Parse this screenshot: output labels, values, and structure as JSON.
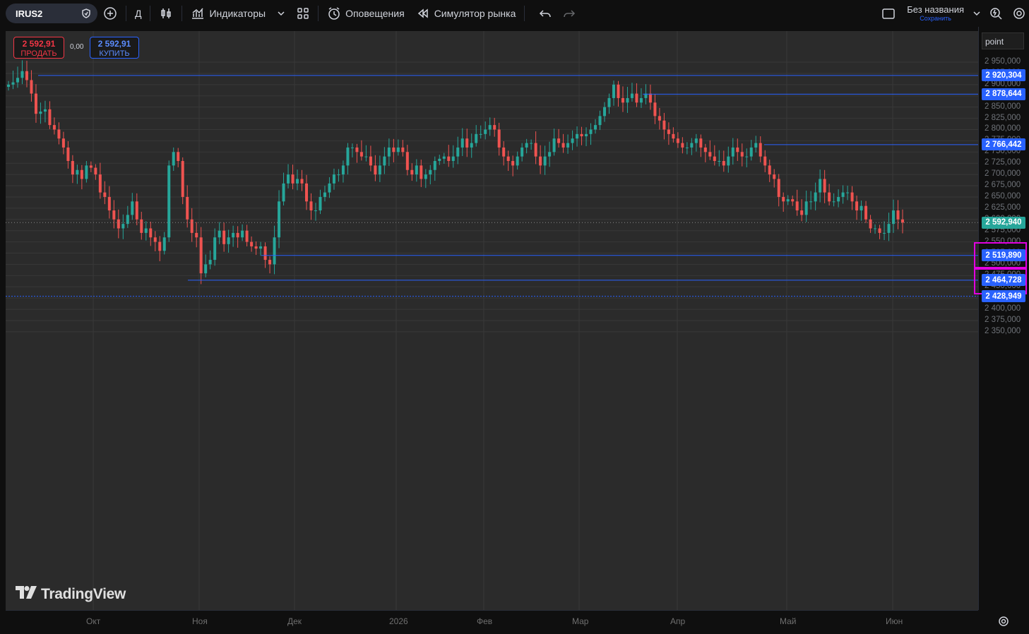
{
  "toolbar": {
    "symbol": "IRUS2",
    "interval": "Д",
    "indicators_label": "Индикаторы",
    "alerts_label": "Оповещения",
    "replay_label": "Симулятор рынка",
    "layout_name": "Без названия",
    "layout_save": "Сохранить"
  },
  "trade": {
    "sell_price": "2 592,91",
    "sell_label": "ПРОДАТЬ",
    "spread": "0,00",
    "buy_price": "2 592,91",
    "buy_label": "КУПИТЬ"
  },
  "price_scale": {
    "mode_label": "point",
    "ticks": [
      "2 950,000",
      "2 925,000",
      "2 900,000",
      "2 875,000",
      "2 850,000",
      "2 825,000",
      "2 800,000",
      "2 775,000",
      "2 750,000",
      "2 725,000",
      "2 700,000",
      "2 675,000",
      "2 650,000",
      "2 625,000",
      "2 600,000",
      "2 575,000",
      "2 550,000",
      "2 525,000",
      "2 500,000",
      "2 475,000",
      "2 450,000",
      "2 425,000",
      "2 400,000",
      "2 375,000",
      "2 350,000"
    ],
    "tick_values": [
      2950,
      2925,
      2900,
      2875,
      2850,
      2825,
      2800,
      2775,
      2750,
      2725,
      2700,
      2675,
      2650,
      2625,
      2600,
      2575,
      2550,
      2525,
      2500,
      2475,
      2450,
      2425,
      2400,
      2375,
      2350
    ]
  },
  "horizontal_lines": [
    {
      "value": 2920.304,
      "label": "2 920,304",
      "color": "#2962ff",
      "highlighted": false
    },
    {
      "value": 2878.644,
      "label": "2 878,644",
      "color": "#2962ff",
      "highlighted": false
    },
    {
      "value": 2766.442,
      "label": "2 766,442",
      "color": "#2962ff",
      "highlighted": false
    },
    {
      "value": 2519.89,
      "label": "2 519,890",
      "color": "#2962ff",
      "highlighted": true
    },
    {
      "value": 2464.728,
      "label": "2 464,728",
      "color": "#2962ff",
      "highlighted": true
    },
    {
      "value": 2428.949,
      "label": "2 428,949",
      "color": "#2962ff",
      "highlighted": false
    }
  ],
  "last_price": {
    "value": 2592.94,
    "label": "2 592,940",
    "color": "#26a69a"
  },
  "time_scale": {
    "labels": [
      "Окт",
      "Ноя",
      "Дек",
      "2026",
      "Фев",
      "Мар",
      "Апр",
      "Май",
      "Июн"
    ]
  },
  "watermark": "TradingView",
  "colors": {
    "up": "#26a69a",
    "down": "#ef5350",
    "background": "#2b2b2b",
    "line": "#2962ff",
    "highlight": "#e100e1"
  },
  "chart_data": {
    "type": "candlestick",
    "symbol": "IRUS2",
    "interval": "1D",
    "ylim": [
      2330,
      2960
    ],
    "x_labels": [
      "Окт",
      "Ноя",
      "Дек",
      "2026",
      "Фев",
      "Мар",
      "Апр",
      "Май",
      "Июн"
    ],
    "closes": [
      2900,
      2905,
      2915,
      2930,
      2910,
      2880,
      2835,
      2840,
      2845,
      2810,
      2800,
      2780,
      2760,
      2730,
      2700,
      2710,
      2690,
      2720,
      2715,
      2700,
      2660,
      2650,
      2620,
      2600,
      2580,
      2590,
      2610,
      2640,
      2600,
      2570,
      2580,
      2560,
      2550,
      2530,
      2560,
      2720,
      2750,
      2730,
      2650,
      2600,
      2570,
      2560,
      2480,
      2500,
      2510,
      2560,
      2575,
      2545,
      2560,
      2570,
      2560,
      2575,
      2550,
      2540,
      2535,
      2540,
      2510,
      2500,
      2560,
      2640,
      2680,
      2700,
      2680,
      2690,
      2680,
      2640,
      2620,
      2620,
      2650,
      2660,
      2680,
      2700,
      2700,
      2720,
      2760,
      2760,
      2750,
      2740,
      2740,
      2720,
      2700,
      2720,
      2740,
      2760,
      2750,
      2760,
      2750,
      2710,
      2700,
      2720,
      2690,
      2700,
      2710,
      2730,
      2735,
      2740,
      2730,
      2740,
      2760,
      2780,
      2760,
      2770,
      2790,
      2790,
      2800,
      2810,
      2800,
      2760,
      2740,
      2730,
      2720,
      2740,
      2760,
      2770,
      2770,
      2740,
      2720,
      2740,
      2750,
      2780,
      2770,
      2760,
      2770,
      2780,
      2790,
      2785,
      2790,
      2800,
      2810,
      2830,
      2850,
      2870,
      2900,
      2870,
      2860,
      2870,
      2880,
      2860,
      2870,
      2880,
      2860,
      2830,
      2820,
      2800,
      2790,
      2780,
      2770,
      2760,
      2760,
      2770,
      2780,
      2760,
      2750,
      2740,
      2730,
      2730,
      2720,
      2740,
      2760,
      2750,
      2740,
      2740,
      2760,
      2770,
      2740,
      2720,
      2700,
      2690,
      2650,
      2640,
      2645,
      2640,
      2620,
      2610,
      2640,
      2640,
      2660,
      2690,
      2660,
      2640,
      2640,
      2650,
      2660,
      2660,
      2640,
      2620,
      2630,
      2600,
      2580,
      2580,
      2570,
      2570,
      2590,
      2620,
      2600,
      2593
    ],
    "key_levels": [
      2920.304,
      2878.644,
      2766.442,
      2519.89,
      2464.728,
      2428.949
    ],
    "last": 2592.94
  }
}
